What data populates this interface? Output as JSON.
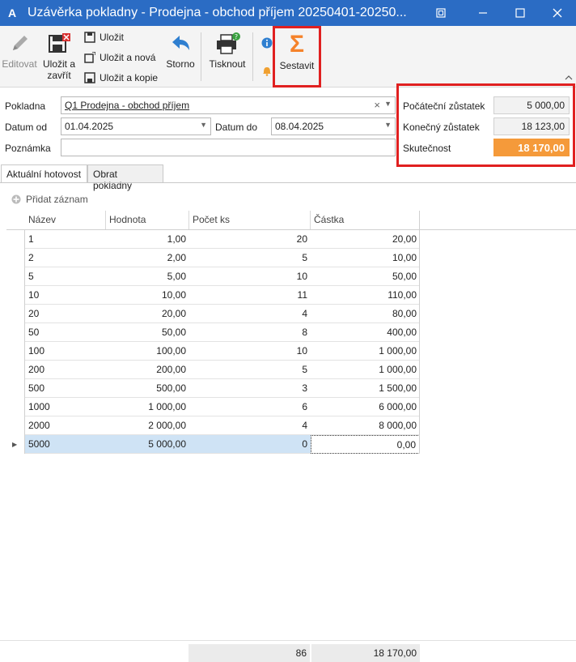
{
  "window": {
    "app_icon": "A",
    "title": "Uzávěrka pokladny - Prodejna - obchod příjem 20250401-20250...",
    "buttons": [
      "settings-icon",
      "minimize-icon",
      "maximize-icon",
      "close-icon"
    ]
  },
  "ribbon": {
    "edit_label": "Editovat",
    "save_close_label_1": "Uložit a",
    "save_close_label_2": "zavřít",
    "save_label": "Uložit",
    "save_new_label": "Uložit a nová",
    "save_copy_label": "Uložit a kopie",
    "cancel_label": "Storno",
    "print_label": "Tisknout",
    "compose_label": "Sestavit",
    "compose_symbol": "Σ",
    "accent_color": "#f5822a"
  },
  "form": {
    "pokladna_label": "Pokladna",
    "pokladna_value": "Q1 Prodejna - obchod příjem",
    "datum_od_label": "Datum od",
    "datum_od_value": "01.04.2025",
    "datum_do_label": "Datum do",
    "datum_do_value": "08.04.2025",
    "poznamka_label": "Poznámka",
    "poznamka_value": ""
  },
  "balances": {
    "start_label": "Počáteční zůstatek",
    "start_value": "5 000,00",
    "end_label": "Konečný zůstatek",
    "end_value": "18 123,00",
    "actual_label": "Skutečnost",
    "actual_value": "18 170,00",
    "actual_color": "#f59a3a"
  },
  "tabs": [
    {
      "label": "Aktuální hotovost",
      "active": true
    },
    {
      "label": "Obrat pokladny",
      "active": false
    }
  ],
  "add_record_label": "Přidat záznam",
  "grid": {
    "columns": [
      "Název",
      "Hodnota",
      "Počet ks",
      "Částka"
    ],
    "rows": [
      [
        "1",
        "1,00",
        "20",
        "20,00"
      ],
      [
        "2",
        "2,00",
        "5",
        "10,00"
      ],
      [
        "5",
        "5,00",
        "10",
        "50,00"
      ],
      [
        "10",
        "10,00",
        "11",
        "110,00"
      ],
      [
        "20",
        "20,00",
        "4",
        "80,00"
      ],
      [
        "50",
        "50,00",
        "8",
        "400,00"
      ],
      [
        "100",
        "100,00",
        "10",
        "1 000,00"
      ],
      [
        "200",
        "200,00",
        "5",
        "1 000,00"
      ],
      [
        "500",
        "500,00",
        "3",
        "1 500,00"
      ],
      [
        "1000",
        "1 000,00",
        "6",
        "6 000,00"
      ],
      [
        "2000",
        "2 000,00",
        "4",
        "8 000,00"
      ],
      [
        "5000",
        "5 000,00",
        "0",
        "0,00"
      ]
    ],
    "selected_row": 11,
    "footer_count": "86",
    "footer_total": "18 170,00"
  }
}
